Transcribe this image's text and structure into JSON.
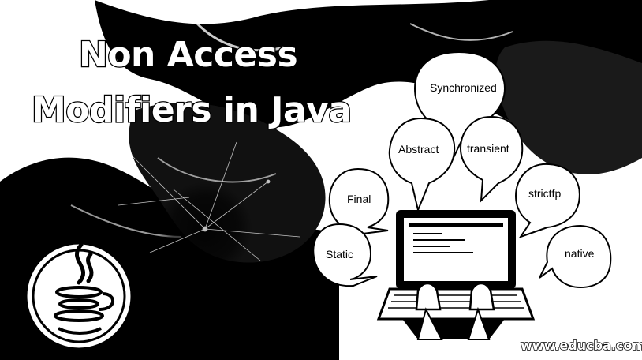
{
  "title": {
    "line1": "Non Access",
    "line2": "Modifiers in Java"
  },
  "bubbles": [
    {
      "id": "synchronized",
      "label": "Synchronized"
    },
    {
      "id": "abstract",
      "label": "Abstract"
    },
    {
      "id": "transient",
      "label": "transient"
    },
    {
      "id": "final",
      "label": "Final"
    },
    {
      "id": "strictfp",
      "label": "strictfp"
    },
    {
      "id": "static",
      "label": "Static"
    },
    {
      "id": "native",
      "label": "native"
    }
  ],
  "watermark": "www.educba.com",
  "icons": {
    "logo": "java-logo-icon",
    "laptop": "laptop-typing-icon"
  },
  "colors": {
    "ink": "#000000",
    "paper": "#ffffff"
  }
}
